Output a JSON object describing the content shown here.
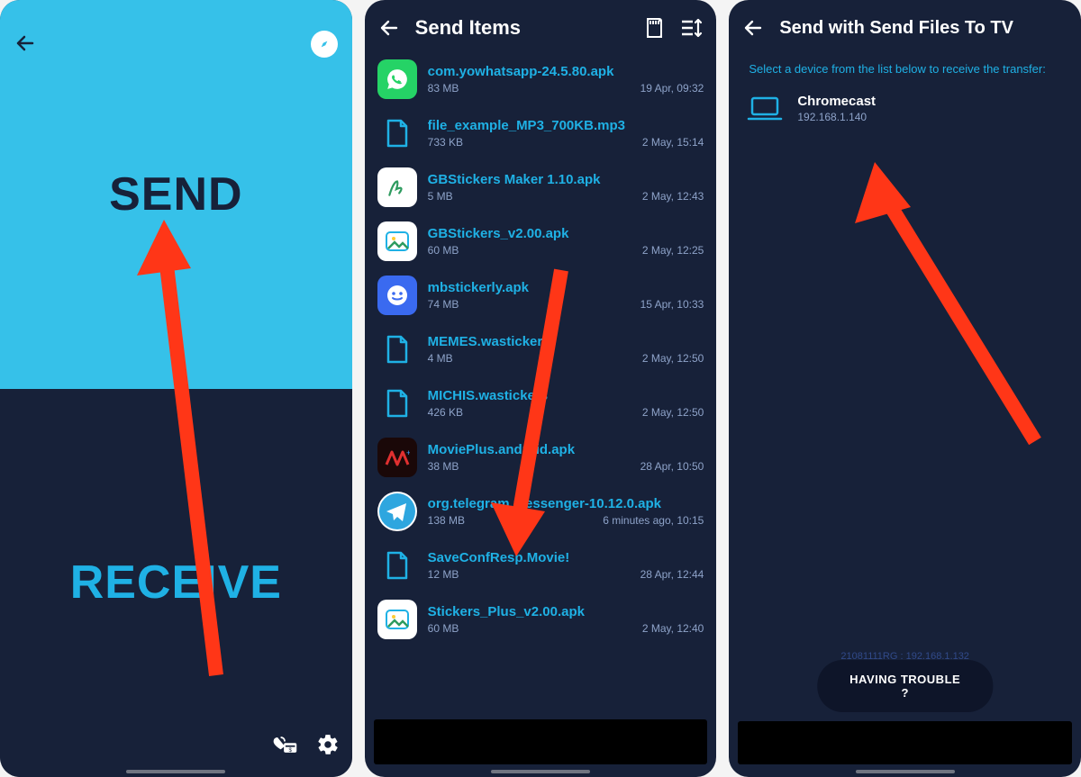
{
  "screen1": {
    "send_label": "SEND",
    "receive_label": "RECEIVE"
  },
  "screen2": {
    "title": "Send Items",
    "files": [
      {
        "name": "com.yowhatsapp-24.5.80.apk",
        "size": "83 MB",
        "date": "19 Apr, 09:32",
        "iconType": "whatsapp"
      },
      {
        "name": "file_example_MP3_700KB.mp3",
        "size": "733 KB",
        "date": "2 May, 15:14",
        "iconType": "doc"
      },
      {
        "name": "GBStickers Maker 1.10.apk",
        "size": "5 MB",
        "date": "2 May, 12:43",
        "iconType": "gbmaker"
      },
      {
        "name": "GBStickers_v2.00.apk",
        "size": "60 MB",
        "date": "2 May, 12:25",
        "iconType": "gallery"
      },
      {
        "name": "mbstickerly.apk",
        "size": "74 MB",
        "date": "15 Apr, 10:33",
        "iconType": "sticker"
      },
      {
        "name": "MEMES.wastickers",
        "size": "4 MB",
        "date": "2 May, 12:50",
        "iconType": "doc"
      },
      {
        "name": "MICHIS.wastickers",
        "size": "426 KB",
        "date": "2 May, 12:50",
        "iconType": "doc"
      },
      {
        "name": "MoviePlus.android.apk",
        "size": "38 MB",
        "date": "28 Apr, 10:50",
        "iconType": "movieplus"
      },
      {
        "name": "org.telegram.messenger-10.12.0.apk",
        "size": "138 MB",
        "date": "6 minutes ago, 10:15",
        "iconType": "telegram"
      },
      {
        "name": "SaveConfResp.Movie!",
        "size": "12 MB",
        "date": "28 Apr, 12:44",
        "iconType": "doc"
      },
      {
        "name": "Stickers_Plus_v2.00.apk",
        "size": "60 MB",
        "date": "2 May, 12:40",
        "iconType": "gallery"
      }
    ]
  },
  "screen3": {
    "title": "Send with Send Files To TV",
    "prompt": "Select a device from the list below to receive the transfer:",
    "device_name": "Chromecast",
    "device_ip": "192.168.1.140",
    "self_id": "21081111RG : 192.168.1.132",
    "trouble_label": "HAVING TROUBLE ?"
  }
}
